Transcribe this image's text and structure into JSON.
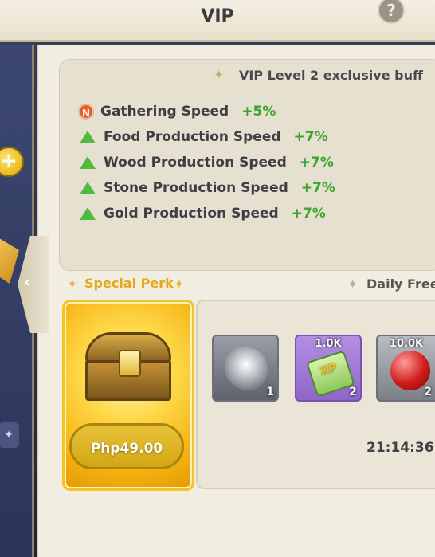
{
  "header": {
    "title": "VIP",
    "help_label": "?"
  },
  "left_strip": {
    "plus_label": "+",
    "back_arrow": "‹"
  },
  "buff": {
    "title": "VIP Level 2 exclusive buff",
    "rows": [
      {
        "icon": "n-badge-icon",
        "badge": "N",
        "name": "Gathering Speed",
        "value": "+5%"
      },
      {
        "icon": "up-arrow-icon",
        "name": "Food Production Speed",
        "value": "+7%"
      },
      {
        "icon": "up-arrow-icon",
        "name": "Wood Production Speed",
        "value": "+7%"
      },
      {
        "icon": "up-arrow-icon",
        "name": "Stone Production Speed",
        "value": "+7%"
      },
      {
        "icon": "up-arrow-icon",
        "name": "Gold Production Speed",
        "value": "+7%"
      }
    ]
  },
  "special_perk": {
    "title": "Special Perk",
    "price": "Php49.00"
  },
  "daily_free": {
    "title": "Daily Free",
    "items": [
      {
        "icon": "diamond-ore-icon",
        "badge": "",
        "qty": "1"
      },
      {
        "icon": "xp-scroll-icon",
        "badge": "1.0K",
        "qty": "2"
      },
      {
        "icon": "apple-icon",
        "badge": "10.0K",
        "qty": "2"
      }
    ],
    "timer": "21:14:36"
  },
  "colors": {
    "positive": "#3aa52f",
    "perk_gold": "#e2a81a",
    "panel_bg": "#f2ede1"
  }
}
